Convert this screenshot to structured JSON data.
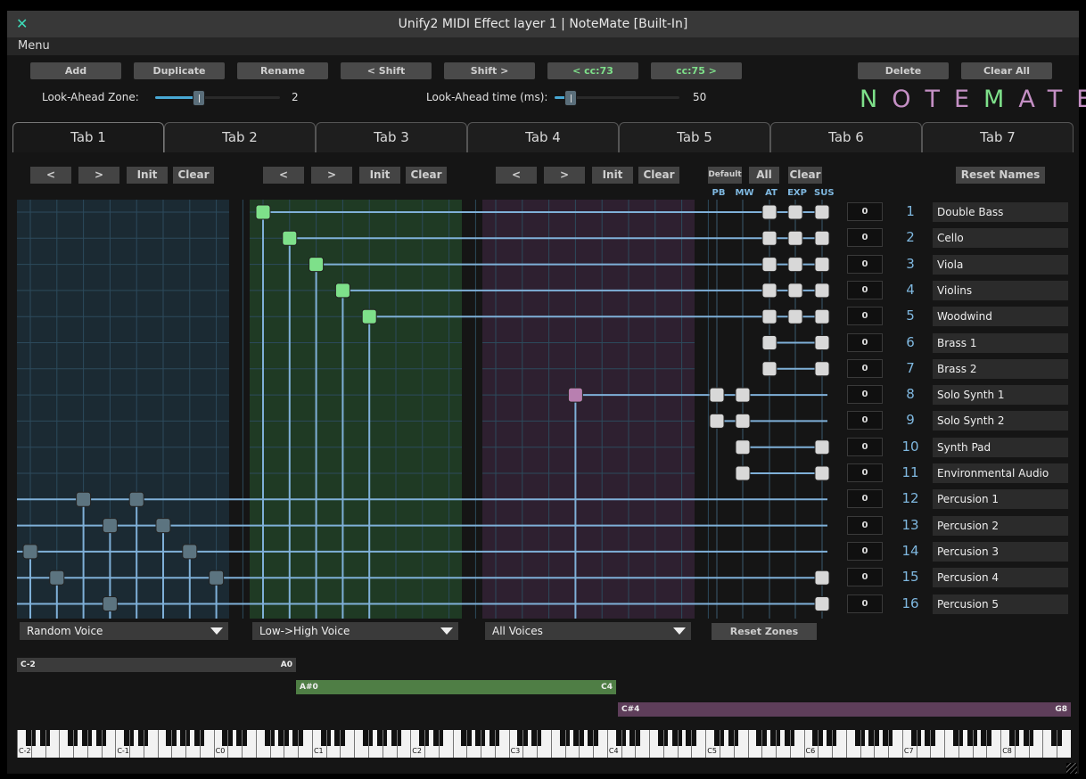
{
  "window": {
    "title": "Unify2 MIDI Effect layer 1 | NoteMate [Built-In]",
    "close_icon": "close-icon"
  },
  "menu": {
    "label": "Menu"
  },
  "toolbar": {
    "buttons": [
      "Add",
      "Duplicate",
      "Rename",
      "< Shift",
      "Shift >",
      "< cc:73",
      "cc:75 >",
      "Delete",
      "Clear All"
    ]
  },
  "lookahead": {
    "zone_label": "Look-Ahead Zone:",
    "zone_value": "2",
    "zone_level": 0.35,
    "time_label": "Look-Ahead time (ms):",
    "time_value": "50",
    "time_level": 0.13
  },
  "logo": {
    "text": "NOTEMATE",
    "color_a": "#7ee08a",
    "color_b": "#c48fc4"
  },
  "tabs": [
    "Tab 1",
    "Tab 2",
    "Tab 3",
    "Tab 4",
    "Tab 5",
    "Tab 6",
    "Tab 7"
  ],
  "active_tab": 0,
  "zone_buttons": [
    "<",
    ">",
    "Init",
    "Clear"
  ],
  "cc_buttons": {
    "default": "Default",
    "all": "All",
    "clear": "Clear",
    "reset_names": "Reset Names"
  },
  "cc_headers": [
    "PB",
    "MW",
    "AT",
    "EXP",
    "SUS"
  ],
  "voices": [
    {
      "index": "1",
      "name": "Double Bass",
      "value": "0",
      "zone": 2,
      "pos": 1,
      "pb": false,
      "mw": false,
      "at": true,
      "exp": true,
      "sus": true
    },
    {
      "index": "2",
      "name": "Cello",
      "value": "0",
      "zone": 2,
      "pos": 2,
      "pb": false,
      "mw": false,
      "at": true,
      "exp": true,
      "sus": true
    },
    {
      "index": "3",
      "name": "Viola",
      "value": "0",
      "zone": 2,
      "pos": 3,
      "pb": false,
      "mw": false,
      "at": true,
      "exp": true,
      "sus": true
    },
    {
      "index": "4",
      "name": "Violins",
      "value": "0",
      "zone": 2,
      "pos": 4,
      "pb": false,
      "mw": false,
      "at": true,
      "exp": true,
      "sus": true
    },
    {
      "index": "5",
      "name": "Woodwind",
      "value": "0",
      "zone": 2,
      "pos": 5,
      "pb": false,
      "mw": false,
      "at": true,
      "exp": true,
      "sus": true
    },
    {
      "index": "6",
      "name": "Brass 1",
      "value": "0",
      "zone": 0,
      "pos": 0,
      "pb": false,
      "mw": false,
      "at": true,
      "exp": false,
      "sus": true
    },
    {
      "index": "7",
      "name": "Brass 2",
      "value": "0",
      "zone": 0,
      "pos": 0,
      "pb": false,
      "mw": false,
      "at": true,
      "exp": false,
      "sus": true
    },
    {
      "index": "8",
      "name": "Solo Synth 1",
      "value": "0",
      "zone": 3,
      "pos": 4,
      "pb": true,
      "mw": true,
      "at": false,
      "exp": false,
      "sus": false
    },
    {
      "index": "9",
      "name": "Solo Synth 2",
      "value": "0",
      "zone": 0,
      "pos": 0,
      "pb": true,
      "mw": true,
      "at": false,
      "exp": false,
      "sus": false
    },
    {
      "index": "10",
      "name": "Synth Pad",
      "value": "0",
      "zone": 0,
      "pos": 0,
      "pb": false,
      "mw": true,
      "at": false,
      "exp": false,
      "sus": true
    },
    {
      "index": "11",
      "name": "Environmental Audio",
      "value": "0",
      "zone": 0,
      "pos": 0,
      "pb": false,
      "mw": true,
      "at": false,
      "exp": false,
      "sus": true
    },
    {
      "index": "12",
      "name": "Percusion 1",
      "value": "0",
      "zone": 1,
      "pos": 3,
      "pb": false,
      "mw": false,
      "at": false,
      "exp": false,
      "sus": false
    },
    {
      "index": "13",
      "name": "Percusion 2",
      "value": "0",
      "zone": 1,
      "pos": 4,
      "pb": false,
      "mw": false,
      "at": false,
      "exp": false,
      "sus": false
    },
    {
      "index": "14",
      "name": "Percusion 3",
      "value": "0",
      "zone": 1,
      "pos": 1,
      "pb": false,
      "mw": false,
      "at": false,
      "exp": false,
      "sus": false
    },
    {
      "index": "15",
      "name": "Percusion 4",
      "value": "0",
      "zone": 1,
      "pos": 2,
      "pb": false,
      "mw": false,
      "at": false,
      "exp": false,
      "sus": true
    },
    {
      "index": "16",
      "name": "Percusion 5",
      "value": "0",
      "zone": 1,
      "pos": 4,
      "pb": false,
      "mw": false,
      "at": false,
      "exp": false,
      "sus": true
    }
  ],
  "zone1_extra": [
    {
      "voice": 11,
      "pos": 5
    },
    {
      "voice": 12,
      "pos": 6
    },
    {
      "voice": 13,
      "pos": 7
    },
    {
      "voice": 14,
      "pos": 8
    }
  ],
  "dropdowns": [
    "Random Voice",
    "Low->High Voice",
    "All Voices"
  ],
  "reset_zones": "Reset Zones",
  "key_zones": [
    {
      "low": "C-2",
      "high": "A0",
      "color": "#3b3b3b"
    },
    {
      "low": "A#0",
      "high": "C4",
      "color": "#4f7e45"
    },
    {
      "low": "C#4",
      "high": "G8",
      "color": "#5e3e5a"
    }
  ],
  "octave_labels": [
    "C-2",
    "C-1",
    "C0",
    "C1",
    "C2",
    "C3",
    "C4",
    "C5",
    "C6",
    "C7",
    "C8"
  ],
  "colors": {
    "zone1": "#1b2a33",
    "zone2": "#1f3a24",
    "zone3": "#2e2030",
    "line": "#7fb0d8",
    "node1": "#5c7480",
    "node2": "#7ee08a",
    "node3": "#b87fb0",
    "node_cc": "#d8d8d8"
  }
}
